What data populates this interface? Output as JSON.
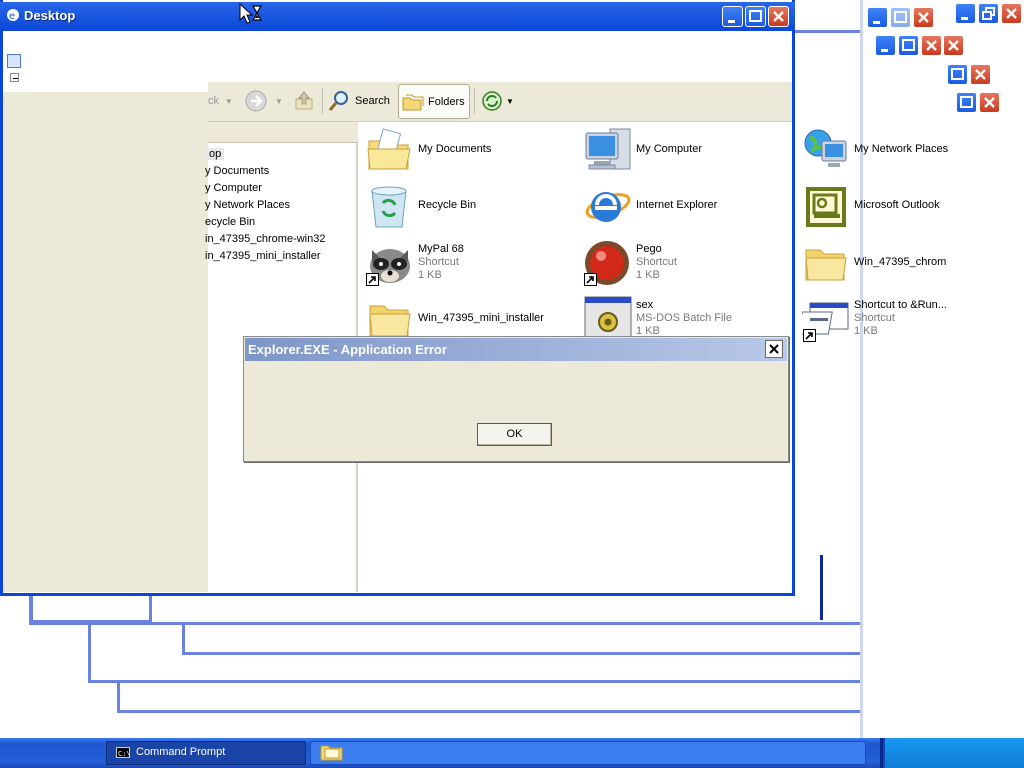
{
  "windows": {
    "front_title": "Desktop"
  },
  "toolbar": {
    "back_label": "ck",
    "search_label": "Search",
    "folders_label": "Folders"
  },
  "tree": {
    "items": [
      {
        "label": "op"
      },
      {
        "label": "y Documents"
      },
      {
        "label": "y Computer"
      },
      {
        "label": "y Network Places"
      },
      {
        "label": "ecycle Bin"
      },
      {
        "label": "in_47395_chrome-win32"
      },
      {
        "label": "in_47395_mini_installer"
      }
    ]
  },
  "files": {
    "my_documents": {
      "name": "My Documents",
      "icon": "folder-documents-icon"
    },
    "my_computer": {
      "name": "My Computer",
      "icon": "computer-icon"
    },
    "my_network_places": {
      "name": "My Network Places",
      "icon": "network-globe-icon"
    },
    "recycle_bin": {
      "name": "Recycle Bin",
      "icon": "recycle-bin-icon"
    },
    "internet_explorer": {
      "name": "Internet Explorer",
      "icon": "ie-icon"
    },
    "microsoft_outlook": {
      "name": "Microsoft Outlook",
      "icon": "outlook-icon"
    },
    "mypal": {
      "name": "MyPal 68",
      "type": "Shortcut",
      "size": "1 KB",
      "icon": "raccoon-icon"
    },
    "pego": {
      "name": "Pego",
      "type": "Shortcut",
      "size": "1 KB",
      "icon": "red-ball-icon"
    },
    "chrome_folder": {
      "name": "Win_47395_chrom",
      "icon": "folder-icon"
    },
    "mini_installer": {
      "name": "Win_47395_mini_installer",
      "icon": "folder-icon"
    },
    "sex": {
      "name": "sex",
      "type": "MS-DOS Batch File",
      "size": "1 KB",
      "icon": "batch-file-icon"
    },
    "run_shortcut": {
      "name": "Shortcut to &Run...",
      "type": "Shortcut",
      "size": "1 KB",
      "icon": "run-icon"
    }
  },
  "dialog": {
    "title": "Explorer.EXE - Application Error",
    "ok_label": "OK"
  },
  "taskbar": {
    "cmd_label": "Command Prompt"
  },
  "colors": {
    "xp_blue_title": "#0a47d8",
    "window_border": "#6b82e0",
    "panel_beige": "#ece9d8",
    "taskbar_blue": "#245edb"
  }
}
